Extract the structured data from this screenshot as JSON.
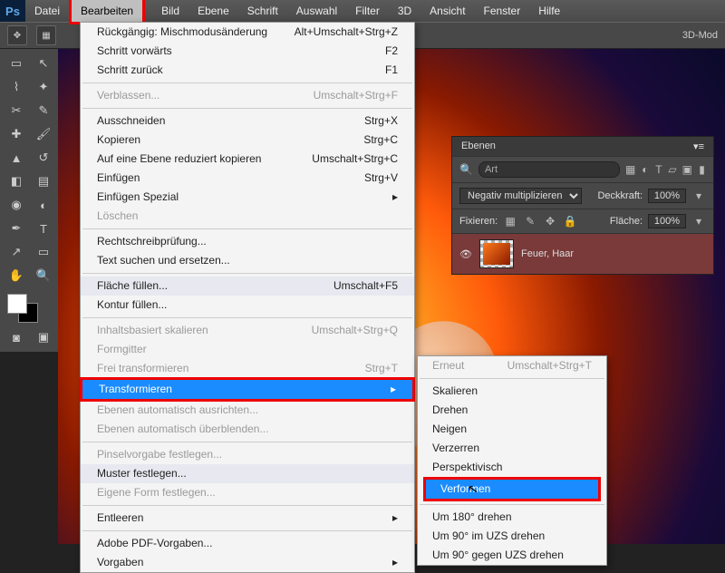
{
  "menubar": {
    "items": [
      "Datei",
      "Bearbeiten",
      "Bild",
      "Ebene",
      "Schrift",
      "Auswahl",
      "Filter",
      "3D",
      "Ansicht",
      "Fenster",
      "Hilfe"
    ],
    "active_index": 1
  },
  "toolbar": {
    "right_label": "3D-Mod"
  },
  "edit_menu": {
    "group1": [
      {
        "label": "Rückgängig: Mischmodusänderung",
        "shortcut": "Alt+Umschalt+Strg+Z"
      },
      {
        "label": "Schritt vorwärts",
        "shortcut": "F2"
      },
      {
        "label": "Schritt zurück",
        "shortcut": "F1"
      }
    ],
    "group2": [
      {
        "label": "Verblassen...",
        "shortcut": "Umschalt+Strg+F",
        "disabled": true
      }
    ],
    "group3": [
      {
        "label": "Ausschneiden",
        "shortcut": "Strg+X"
      },
      {
        "label": "Kopieren",
        "shortcut": "Strg+C"
      },
      {
        "label": "Auf eine Ebene reduziert kopieren",
        "shortcut": "Umschalt+Strg+C"
      },
      {
        "label": "Einfügen",
        "shortcut": "Strg+V"
      },
      {
        "label": "Einfügen Spezial",
        "shortcut": "",
        "arrow": true
      },
      {
        "label": "Löschen",
        "shortcut": "",
        "disabled": true
      }
    ],
    "group4": [
      {
        "label": "Rechtschreibprüfung..."
      },
      {
        "label": "Text suchen und ersetzen..."
      }
    ],
    "group5": [
      {
        "label": "Fläche füllen...",
        "shortcut": "Umschalt+F5",
        "hover": true
      },
      {
        "label": "Kontur füllen..."
      }
    ],
    "group6": [
      {
        "label": "Inhaltsbasiert skalieren",
        "shortcut": "Umschalt+Strg+Q",
        "disabled": true
      },
      {
        "label": "Formgitter",
        "disabled": true
      },
      {
        "label": "Frei transformieren",
        "shortcut": "Strg+T",
        "disabled": true
      },
      {
        "label": "Transformieren",
        "arrow": true,
        "selected": true
      },
      {
        "label": "Ebenen automatisch ausrichten...",
        "disabled": true
      },
      {
        "label": "Ebenen automatisch überblenden...",
        "disabled": true
      }
    ],
    "group7": [
      {
        "label": "Pinselvorgabe festlegen...",
        "disabled": true
      },
      {
        "label": "Muster festlegen...",
        "hover": true
      },
      {
        "label": "Eigene Form festlegen...",
        "disabled": true
      }
    ],
    "group8": [
      {
        "label": "Entleeren",
        "arrow": true
      }
    ],
    "group9": [
      {
        "label": "Adobe PDF-Vorgaben..."
      },
      {
        "label": "Vorgaben",
        "arrow": true
      }
    ]
  },
  "transform_submenu": {
    "top": {
      "label": "Erneut",
      "shortcut": "Umschalt+Strg+T",
      "disabled": true
    },
    "group1": [
      "Skalieren",
      "Drehen",
      "Neigen",
      "Verzerren",
      "Perspektivisch",
      "Verformen"
    ],
    "selected_index": 5,
    "group2": [
      "Um 180° drehen",
      "Um 90° im UZS drehen",
      "Um 90° gegen UZS drehen"
    ]
  },
  "layers_panel": {
    "title": "Ebenen",
    "search": "Art",
    "blend": "Negativ multiplizieren",
    "opacity_label": "Deckkraft:",
    "opacity": "100%",
    "lock_label": "Fixieren:",
    "fill_label": "Fläche:",
    "fill": "100%",
    "layer_name": "Feuer, Haar"
  }
}
